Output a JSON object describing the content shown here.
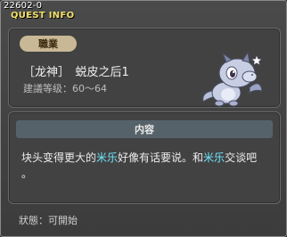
{
  "window": {
    "quest_id": "22602-0",
    "title": "QUEST INFO"
  },
  "quest": {
    "job_label": "職業",
    "name": "［龙神］　蜕皮之后1",
    "level_text": "建議等级：60～64",
    "npc_icon": "baby-dragon-icon"
  },
  "content": {
    "header": "内容",
    "text_1": "块头变得更大的",
    "npc_1": "米乐",
    "text_2": "好像有话要说。和",
    "npc_2": "米乐",
    "text_3": "交谈吧",
    "text_4": "。"
  },
  "status": {
    "text": "狀態：可開始"
  },
  "colors": {
    "title": "#f3e06a",
    "highlight": "#6fe6ff",
    "job_tag": "#c9b896",
    "header_bar": "#56626a"
  }
}
